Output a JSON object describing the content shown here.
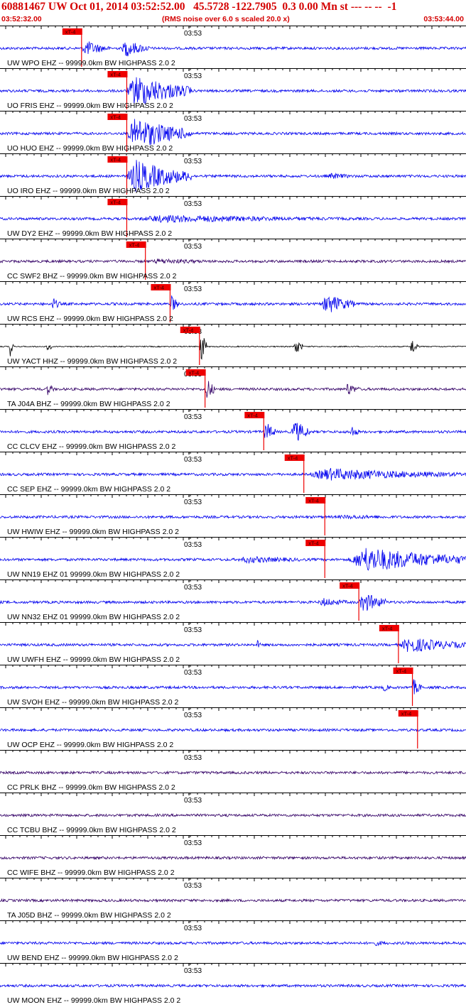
{
  "header": {
    "title": "60881467 UW Oct 01, 2014 03:52:52.00   45.5728 -122.7905  0.3 0.00 Mn st --- -- --  -1",
    "start_time": "03:52:32.00",
    "end_time": "03:53:44.00",
    "noise_note": "(RMS noise over 6.0 s scaled 20.0 x)"
  },
  "chart_data": {
    "type": "line",
    "x_start": "03:52:32.00",
    "x_end": "03:53:44.00",
    "minute_mark_label": "03:53",
    "pick_label": "xT-4",
    "colors": {
      "blue": "#0000ee",
      "purple": "#330066",
      "black": "#000000",
      "pick": "#ee0000"
    },
    "traces": [
      {
        "label": "UW WPO EHZ -- 99999.0km BW  HIGHPASS  2.0  2",
        "color": "blue",
        "pick": 0.175,
        "bursts": [
          [
            0.175,
            0.06,
            4.5
          ],
          [
            0.26,
            0.06,
            5
          ]
        ]
      },
      {
        "label": "UO FRIS EHZ -- 99999.0km BW  HIGHPASS  2.0  2",
        "color": "blue",
        "pick": 0.272,
        "bursts": [
          [
            0.27,
            0.14,
            9
          ]
        ]
      },
      {
        "label": "UO HUO EHZ -- 99999.0km BW  HIGHPASS  2.0  2",
        "color": "blue",
        "pick": 0.272,
        "bursts": [
          [
            0.27,
            0.14,
            9
          ]
        ]
      },
      {
        "label": "UO IRO EHZ -- 99999.0km BW  HIGHPASS  2.0  2",
        "color": "blue",
        "pick": 0.272,
        "bursts": [
          [
            0.27,
            0.14,
            9
          ],
          [
            0.7,
            0.08,
            1.8
          ]
        ]
      },
      {
        "label": "UW DY2 EHZ -- 99999.0km BW  HIGHPASS  2.0  2",
        "color": "blue",
        "pick": 0.272,
        "bursts": [
          [
            0.27,
            0.55,
            2.2
          ]
        ]
      },
      {
        "label": "CC SWF2 BHZ -- 99999.0km BW  HIGHPASS  2.0  2",
        "color": "purple",
        "pick": 0.312,
        "bursts": [
          [
            0.312,
            0.2,
            1.6
          ]
        ]
      },
      {
        "label": "UW RCS EHZ -- 99999.0km BW  HIGHPASS  2.0  2",
        "color": "blue",
        "pick": 0.365,
        "bursts": [
          [
            0.11,
            0.02,
            4
          ],
          [
            0.365,
            0.02,
            5
          ],
          [
            0.69,
            0.07,
            6
          ]
        ]
      },
      {
        "label": "UW YACT HHZ -- 99999.0km BW  HIGHPASS  2.0  2",
        "color": "black",
        "pick": 0.428,
        "bursts": [
          [
            0.02,
            0.01,
            6
          ],
          [
            0.1,
            0.01,
            4
          ],
          [
            0.428,
            0.015,
            10
          ],
          [
            0.63,
            0.02,
            5
          ],
          [
            0.88,
            0.02,
            5
          ]
        ]
      },
      {
        "label": "TA J04A BHZ -- 99999.0km BW  HIGHPASS  2.0  2",
        "color": "purple",
        "pick": 0.44,
        "bursts": [
          [
            0.1,
            0.015,
            4
          ],
          [
            0.44,
            0.02,
            7
          ],
          [
            0.74,
            0.03,
            4
          ]
        ]
      },
      {
        "label": "CC CLCV EHZ -- 99999.0km BW  HIGHPASS  2.0  2",
        "color": "blue",
        "pick": 0.566,
        "bursts": [
          [
            0.566,
            0.025,
            6
          ],
          [
            0.625,
            0.04,
            7
          ],
          [
            0.75,
            0.02,
            4
          ]
        ]
      },
      {
        "label": "CC SEP EHZ -- 99999.0km BW  HIGHPASS  2.0  2",
        "color": "blue",
        "pick": 0.652,
        "bursts": [
          [
            0.652,
            0.35,
            3.5
          ]
        ]
      },
      {
        "label": "UW HWIW EHZ -- 99999.0km BW  HIGHPASS  2.0  2",
        "color": "blue",
        "pick": 0.697,
        "bursts": [
          [
            0.697,
            0.3,
            1.2
          ]
        ]
      },
      {
        "label": "UW NN19 EHZ 01 99999.0km BW  HIGHPASS  2.0  2",
        "color": "blue",
        "pick": 0.697,
        "bursts": [
          [
            0.5,
            0.2,
            2
          ],
          [
            0.745,
            0.27,
            7
          ]
        ]
      },
      {
        "label": "UW NN32 EHZ 01 99999.0km BW  HIGHPASS  2.0  2",
        "color": "blue",
        "pick": 0.77,
        "bursts": [
          [
            0.77,
            0.06,
            6
          ],
          [
            0.68,
            0.08,
            2.5
          ]
        ]
      },
      {
        "label": "UW UWFH EHZ -- 99999.0km BW  HIGHPASS  2.0  2",
        "color": "blue",
        "pick": 0.855,
        "bursts": [
          [
            0.55,
            0.01,
            3
          ],
          [
            0.855,
            0.15,
            4.5
          ]
        ]
      },
      {
        "label": "UW SVOH EHZ -- 99999.0km BW  HIGHPASS  2.0  2",
        "color": "blue",
        "pick": 0.885,
        "bursts": [
          [
            0.82,
            0.02,
            2.5
          ],
          [
            0.885,
            0.02,
            5
          ]
        ]
      },
      {
        "label": "UW OCP EHZ -- 99999.0km BW  HIGHPASS  2.0  2",
        "color": "blue",
        "pick": 0.896,
        "bursts": []
      },
      {
        "label": "CC PRLK BHZ -- 99999.0km BW  HIGHPASS  2.0  2",
        "color": "purple",
        "pick": null,
        "bursts": []
      },
      {
        "label": "CC TCBU BHZ -- 99999.0km BW  HIGHPASS  2.0  2",
        "color": "purple",
        "pick": null,
        "bursts": []
      },
      {
        "label": "CC WIFE BHZ -- 99999.0km BW  HIGHPASS  2.0  2",
        "color": "purple",
        "pick": null,
        "bursts": []
      },
      {
        "label": "TA J05D BHZ -- 99999.0km BW  HIGHPASS  2.0  2",
        "color": "purple",
        "pick": null,
        "bursts": []
      },
      {
        "label": "UW BEND EHZ -- 99999.0km BW  HIGHPASS  2.0  2",
        "color": "blue",
        "pick": null,
        "bursts": [
          [
            0.8,
            0.05,
            1.5
          ]
        ]
      },
      {
        "label": "UW MOON EHZ -- 99999.0km BW  HIGHPASS  2.0  2",
        "color": "blue",
        "pick": null,
        "bursts": []
      }
    ]
  }
}
